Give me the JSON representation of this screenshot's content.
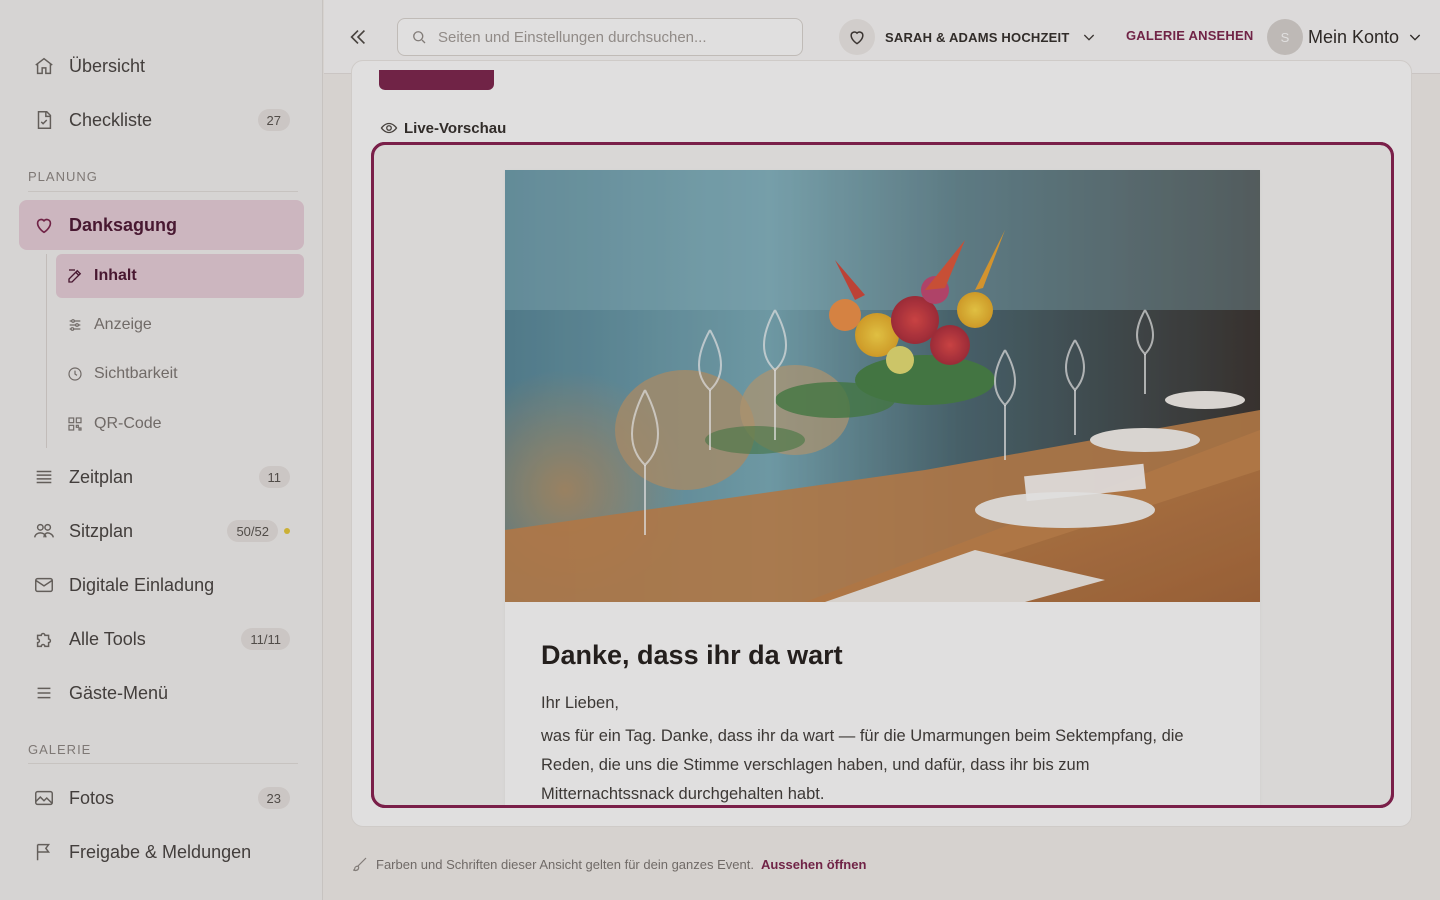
{
  "sidebar": {
    "main_items": [
      {
        "label": "Übersicht",
        "icon": "home-icon"
      },
      {
        "label": "Checkliste",
        "badge": "27",
        "icon": "checklist-icon"
      }
    ],
    "section_planung": "PLANUNG",
    "danksagung": {
      "label": "Danksagung",
      "icon": "heart-icon"
    },
    "sub_items": [
      {
        "label": "Inhalt",
        "icon": "edit-icon"
      },
      {
        "label": "Anzeige",
        "icon": "sliders-icon"
      },
      {
        "label": "Sichtbarkeit",
        "icon": "clock-icon"
      },
      {
        "label": "QR-Code",
        "icon": "qr-icon"
      }
    ],
    "planning_items": [
      {
        "label": "Zeitplan",
        "badge": "11",
        "icon": "list-icon"
      },
      {
        "label": "Sitzplan",
        "badge": "50/52",
        "icon": "people-icon"
      },
      {
        "label": "Digitale Einladung",
        "icon": "mail-icon"
      },
      {
        "label": "Alle Tools",
        "badge": "11/11",
        "icon": "puzzle-icon"
      },
      {
        "label": "Gäste-Menü",
        "icon": "menu-icon"
      }
    ],
    "section_galerie": "GALERIE",
    "gallery_items": [
      {
        "label": "Fotos",
        "badge": "23",
        "icon": "image-icon"
      },
      {
        "label": "Freigabe & Meldungen",
        "icon": "flag-icon"
      }
    ]
  },
  "topbar": {
    "search_placeholder": "Seiten und Einstellungen durchsuchen...",
    "event_name": "SARAH & ADAMS HOCHZEIT",
    "gallery_link": "GALERIE ANSEHEN",
    "avatar_initial": "S",
    "account_label": "Mein Konto"
  },
  "preview": {
    "label": "Live-Vorschau",
    "title": "Danke, dass ihr da wart",
    "greeting": "Ihr Lieben,",
    "body": "was für ein Tag. Danke, dass ihr da wart — für die Umarmungen beim Sektempfang, die Reden, die uns die Stimme verschlagen haben, und dafür, dass ihr bis zum Mitternachtssnack durchgehalten habt."
  },
  "footer": {
    "hint": "Farben und Schriften dieser Ansicht gelten für dein ganzes Event.",
    "link": "Aussehen öffnen"
  },
  "colors": {
    "accent": "#7a1f49",
    "active_bg": "#e8cfd9",
    "status_dot": "#e6c836"
  }
}
